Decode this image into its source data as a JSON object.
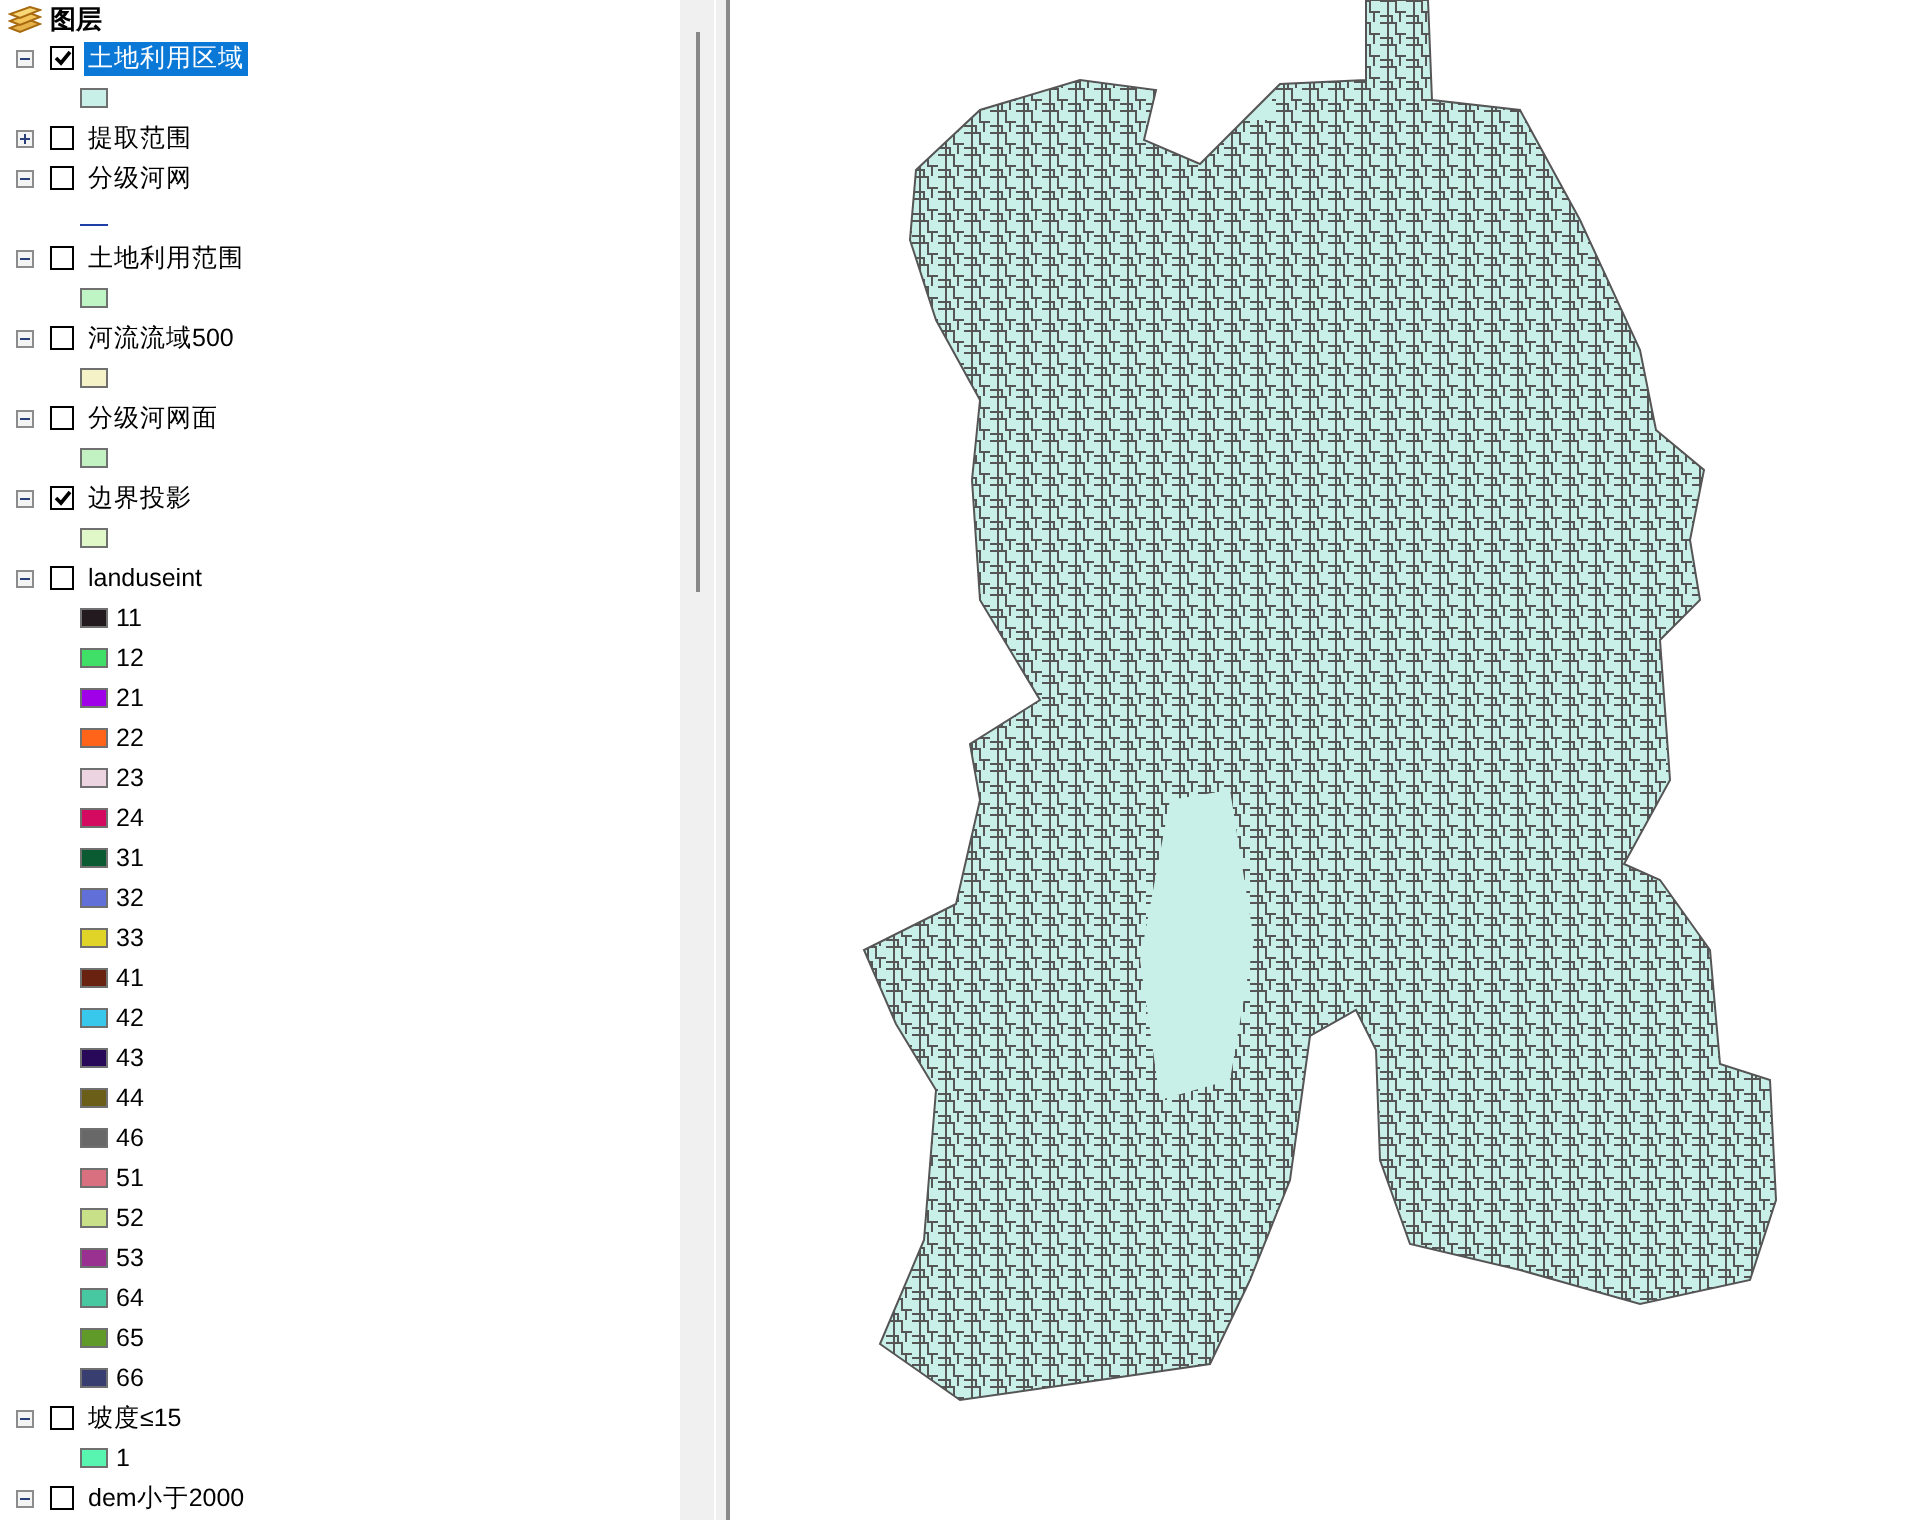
{
  "toc": {
    "title": "图层",
    "layers": [
      {
        "name": "土地利用区域",
        "expanded": true,
        "checked": true,
        "selected": true,
        "legend": [
          {
            "kind": "fill",
            "color": "#c8f0e8"
          }
        ]
      },
      {
        "name": "提取范围",
        "expanded": false,
        "checked": false,
        "selected": false
      },
      {
        "name": "分级河网",
        "expanded": true,
        "checked": false,
        "selected": false,
        "legend": [
          {
            "kind": "line",
            "color": "#1f3fa8"
          }
        ]
      },
      {
        "name": "土地利用范围",
        "expanded": true,
        "checked": false,
        "selected": false,
        "legend": [
          {
            "kind": "fill",
            "color": "#bff5c4"
          }
        ]
      },
      {
        "name": "河流流域500",
        "expanded": true,
        "checked": false,
        "selected": false,
        "legend": [
          {
            "kind": "fill",
            "color": "#f5f2c8"
          }
        ]
      },
      {
        "name": "分级河网面",
        "expanded": true,
        "checked": false,
        "selected": false,
        "legend": [
          {
            "kind": "fill",
            "color": "#c3f2c2"
          }
        ]
      },
      {
        "name": "边界投影",
        "expanded": true,
        "checked": true,
        "selected": false,
        "legend": [
          {
            "kind": "fill",
            "color": "#e0f7c8"
          }
        ]
      },
      {
        "name": "landuseint",
        "expanded": true,
        "checked": false,
        "selected": false,
        "legend": [
          {
            "kind": "fill",
            "color": "#231a20",
            "label": "11"
          },
          {
            "kind": "fill",
            "color": "#40e068",
            "label": "12"
          },
          {
            "kind": "fill",
            "color": "#a000e8",
            "label": "21"
          },
          {
            "kind": "fill",
            "color": "#ff6418",
            "label": "22"
          },
          {
            "kind": "fill",
            "color": "#ecd4e0",
            "label": "23"
          },
          {
            "kind": "fill",
            "color": "#d40a60",
            "label": "24"
          },
          {
            "kind": "fill",
            "color": "#0a5a32",
            "label": "31"
          },
          {
            "kind": "fill",
            "color": "#6070d8",
            "label": "32"
          },
          {
            "kind": "fill",
            "color": "#e0d428",
            "label": "33"
          },
          {
            "kind": "fill",
            "color": "#6a2210",
            "label": "41"
          },
          {
            "kind": "fill",
            "color": "#38c8ec",
            "label": "42"
          },
          {
            "kind": "fill",
            "color": "#280858",
            "label": "43"
          },
          {
            "kind": "fill",
            "color": "#6a5e18",
            "label": "44"
          },
          {
            "kind": "fill",
            "color": "#686868",
            "label": "46"
          },
          {
            "kind": "fill",
            "color": "#d87080",
            "label": "51"
          },
          {
            "kind": "fill",
            "color": "#c8e088",
            "label": "52"
          },
          {
            "kind": "fill",
            "color": "#9a3090",
            "label": "53"
          },
          {
            "kind": "fill",
            "color": "#48c8a0",
            "label": "64"
          },
          {
            "kind": "fill",
            "color": "#609a28",
            "label": "65"
          },
          {
            "kind": "fill",
            "color": "#383e70",
            "label": "66"
          }
        ]
      },
      {
        "name": "坡度≤15",
        "expanded": true,
        "checked": false,
        "selected": false,
        "legend": [
          {
            "kind": "fill",
            "color": "#58f5b0",
            "label": "1"
          }
        ]
      },
      {
        "name": "dem小于2000",
        "expanded": true,
        "checked": false,
        "selected": false
      }
    ]
  }
}
